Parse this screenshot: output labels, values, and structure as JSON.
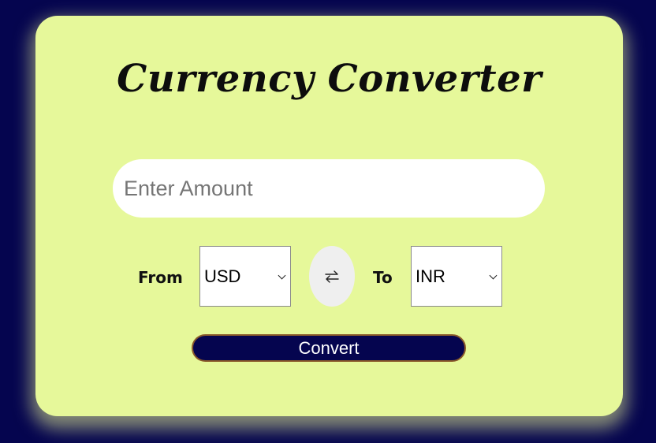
{
  "app": {
    "title": "Currency Converter"
  },
  "amount": {
    "placeholder": "Enter Amount",
    "value": ""
  },
  "from": {
    "label": "From",
    "selected": "USD"
  },
  "to": {
    "label": "To",
    "selected": "INR"
  },
  "swap": {
    "icon": "swap-arrows-icon"
  },
  "convert": {
    "label": "Convert"
  },
  "colors": {
    "page_background": "#05054f",
    "card_background": "#e6f89a",
    "button_background": "#05054f",
    "button_border": "#8a5a2a",
    "swap_background": "#efefef"
  }
}
